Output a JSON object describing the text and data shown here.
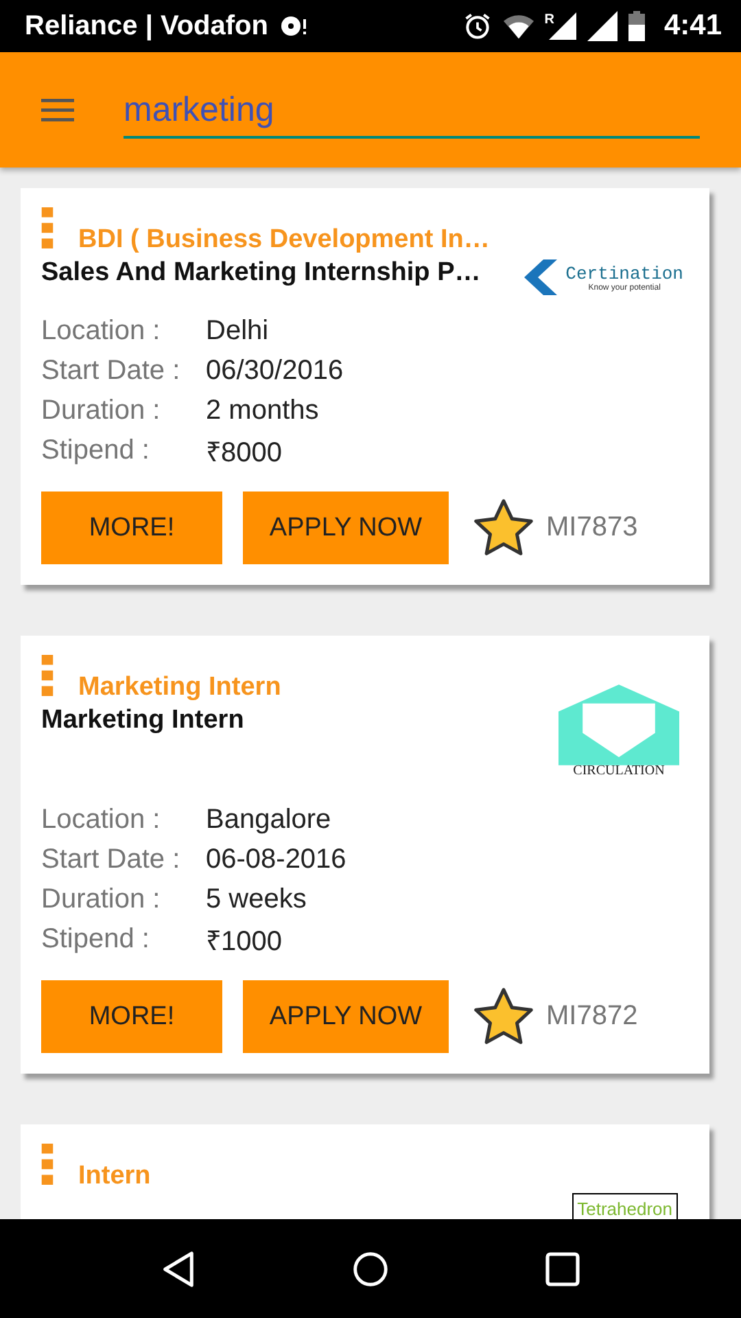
{
  "status_bar": {
    "carrier": "Reliance | Vodafon",
    "time": "4:41",
    "roaming": "R"
  },
  "search": {
    "value": "marketing"
  },
  "listings": [
    {
      "category": "BDI ( Business Development In…",
      "title": "Sales And Marketing Internship P…",
      "logo": {
        "kind": "certination",
        "name": "Certination",
        "tagline": "Know your potential"
      },
      "details": [
        {
          "label": "Location :",
          "value": "Delhi"
        },
        {
          "label": "Start Date :",
          "value": "06/30/2016"
        },
        {
          "label": "Duration :",
          "value": "2 months"
        },
        {
          "label": "Stipend :",
          "value": "₹8000"
        }
      ],
      "more": "MORE!",
      "apply": "APPLY NOW",
      "code": "MI7873"
    },
    {
      "category": "Marketing Intern",
      "title": "Marketing Intern",
      "logo": {
        "kind": "circulation",
        "name": "CIRCULATION"
      },
      "details": [
        {
          "label": "Location :",
          "value": "Bangalore"
        },
        {
          "label": "Start Date :",
          "value": "06-08-2016"
        },
        {
          "label": "Duration :",
          "value": "5 weeks"
        },
        {
          "label": "Stipend :",
          "value": "₹1000"
        }
      ],
      "more": "MORE!",
      "apply": "APPLY NOW",
      "code": "MI7872"
    },
    {
      "category": "Intern",
      "logo": {
        "kind": "tetrahedron",
        "name": "Tetrahedron"
      }
    }
  ]
}
